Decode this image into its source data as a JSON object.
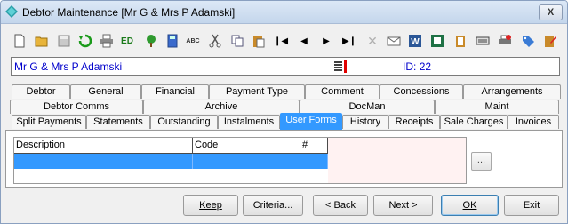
{
  "window": {
    "title": "Debtor Maintenance  [Mr G & Mrs P Adamski]",
    "close_glyph": "X"
  },
  "toolbar": {
    "icons": [
      "new-icon",
      "open-folder-icon",
      "save-icon",
      "refresh-icon",
      "print-icon",
      "ed-icon",
      "tree-icon",
      "calculator-icon",
      "spellcheck-icon",
      "cut-icon",
      "copy-icon",
      "paste-icon",
      "first-record-icon",
      "previous-record-icon",
      "next-record-icon",
      "last-record-icon",
      "delete-icon",
      "email-icon",
      "word-icon",
      "excel-icon",
      "clipboard-icon",
      "keyboard-icon",
      "printer-settings-icon",
      "tag-icon",
      "edit-note-icon"
    ],
    "ed_text": "ED",
    "abc_text": "ABC"
  },
  "infobar": {
    "name": "Mr G & Mrs P Adamski",
    "id_label": "ID:",
    "id_value": "22"
  },
  "tabs": {
    "row1": [
      "Debtor",
      "General",
      "Financial",
      "Payment Type",
      "Comment",
      "Concessions",
      "Arrangements"
    ],
    "row2": [
      "Debtor Comms",
      "Archive",
      "DocMan",
      "Maint"
    ],
    "row3": [
      "Split Payments",
      "Statements",
      "Outstanding",
      "Instalments",
      "User Forms",
      "History",
      "Receipts",
      "Sale Charges",
      "Invoices"
    ],
    "active": "User Forms"
  },
  "grid": {
    "columns": [
      "Description",
      "Code",
      "#"
    ],
    "rows": [
      [
        "",
        "",
        ""
      ]
    ]
  },
  "ellipsis_label": "...",
  "buttons": {
    "keep": "Keep",
    "criteria": "Criteria...",
    "back": "< Back",
    "next": "Next >",
    "ok": "OK",
    "exit": "Exit"
  },
  "colors": {
    "selection": "#3399ff",
    "info_text": "#0000cc",
    "notes_flag": "#e00000"
  }
}
